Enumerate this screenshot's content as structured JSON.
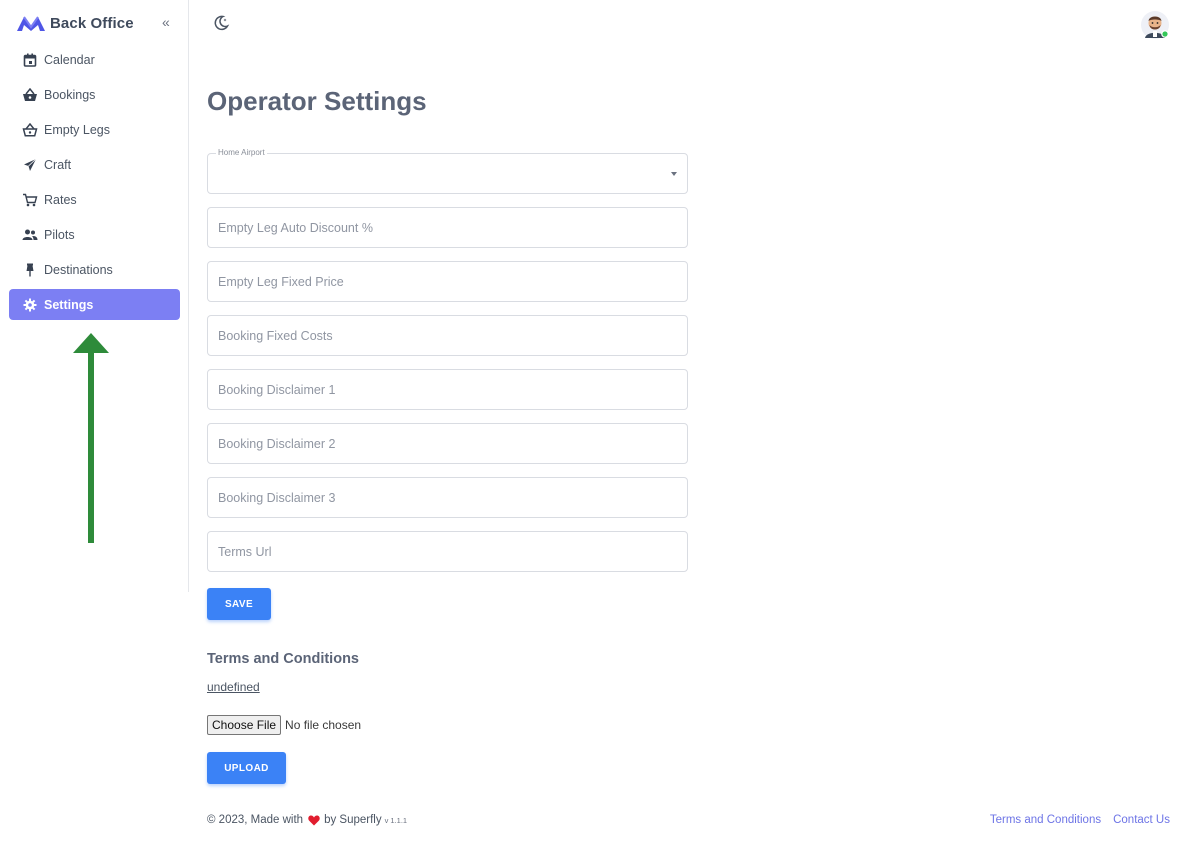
{
  "app": {
    "name": "Back Office"
  },
  "sidebar": {
    "collapse_label": "«",
    "items": [
      {
        "label": "Calendar",
        "icon": "calendar-icon",
        "active": false
      },
      {
        "label": "Bookings",
        "icon": "basket-icon",
        "active": false
      },
      {
        "label": "Empty Legs",
        "icon": "basket-outline-icon",
        "active": false
      },
      {
        "label": "Craft",
        "icon": "airplane-icon",
        "active": false
      },
      {
        "label": "Rates",
        "icon": "cart-icon",
        "active": false
      },
      {
        "label": "Pilots",
        "icon": "people-icon",
        "active": false
      },
      {
        "label": "Destinations",
        "icon": "pin-icon",
        "active": false
      },
      {
        "label": "Settings",
        "icon": "gear-icon",
        "active": true
      }
    ]
  },
  "header": {
    "theme_icon": "moon-icon",
    "avatar_icon": "user-avatar-icon"
  },
  "main": {
    "title": "Operator Settings",
    "home_airport": {
      "label": "Home Airport",
      "value": ""
    },
    "fields": [
      {
        "placeholder": "Empty Leg Auto Discount %",
        "value": ""
      },
      {
        "placeholder": "Empty Leg Fixed Price",
        "value": ""
      },
      {
        "placeholder": "Booking Fixed Costs",
        "value": ""
      },
      {
        "placeholder": "Booking Disclaimer 1",
        "value": ""
      },
      {
        "placeholder": "Booking Disclaimer 2",
        "value": ""
      },
      {
        "placeholder": "Booking Disclaimer 3",
        "value": ""
      },
      {
        "placeholder": "Terms Url",
        "value": ""
      }
    ],
    "save_label": "SAVE",
    "terms_section": {
      "title": "Terms and Conditions",
      "link_text": "undefined",
      "choose_file_label": "Choose File",
      "file_status": "No file chosen",
      "upload_label": "UPLOAD"
    }
  },
  "footer": {
    "copyright_prefix": "© 2023, Made with",
    "by_text": "by Superfly",
    "version": "v 1.1.1",
    "links": [
      "Terms and Conditions",
      "Contact Us"
    ]
  },
  "colors": {
    "accent": "#7c7ff3",
    "button": "#3b82f6",
    "annotation_arrow": "#2e8b3a",
    "heart": "#e11d2e",
    "footer_link": "#6d74e6"
  }
}
